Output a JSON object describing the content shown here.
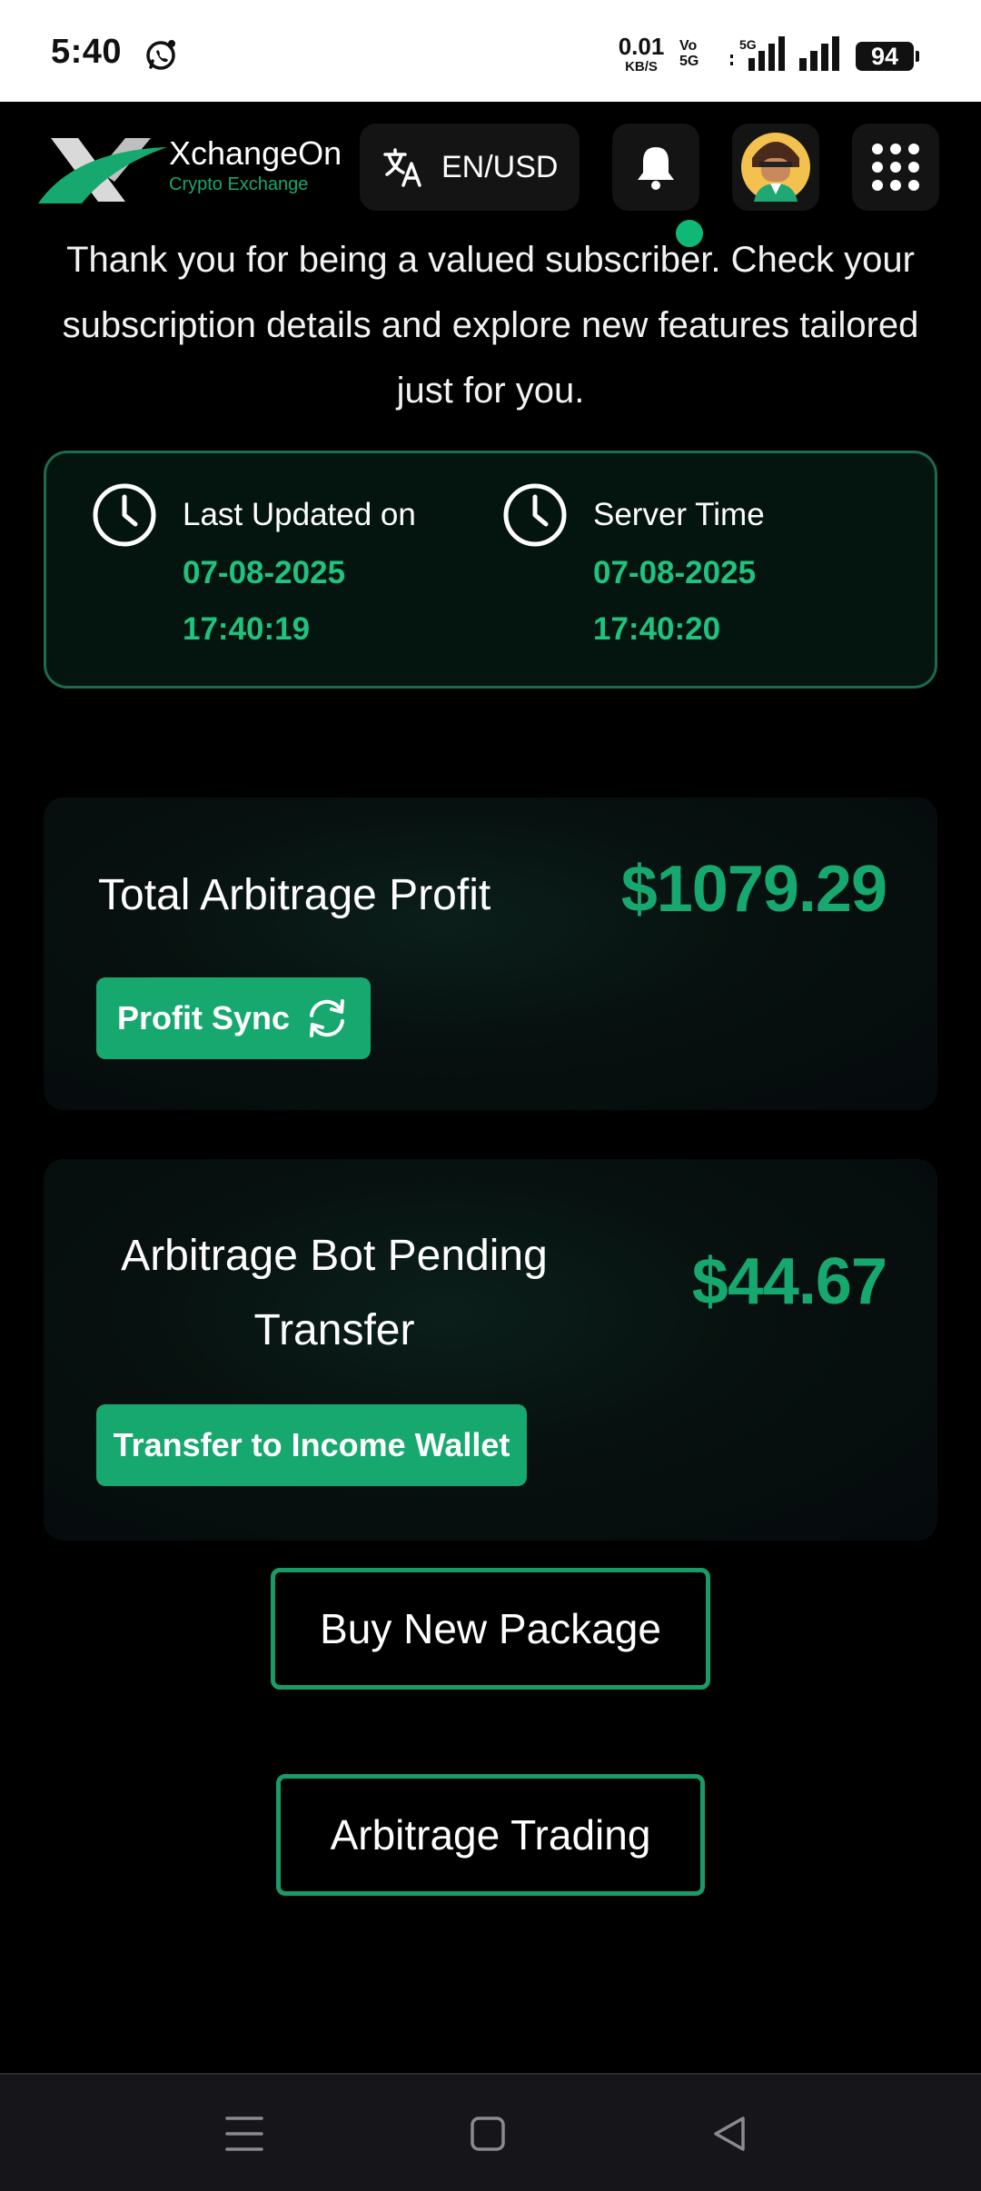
{
  "status_bar": {
    "time": "5:40",
    "net_speed": "0.01",
    "net_unit": "KB/S",
    "volte_top": "Vo",
    "volte_bottom": "5G",
    "network_type": "5G",
    "battery": "94"
  },
  "header": {
    "brand_name": "XchangeOn",
    "brand_subtitle": "Crypto Exchange",
    "language_label": "EN/USD",
    "colors": {
      "accent": "#17a870",
      "notification_dot": "#0fb876"
    }
  },
  "intro_text": "Thank you for being a valued subscriber. Check your subscription details and explore new features tailored just for you.",
  "time_card": {
    "last_updated": {
      "label": "Last Updated on",
      "date": "07-08-2025",
      "time": "17:40:19"
    },
    "server_time": {
      "label": "Server Time",
      "date": "07-08-2025",
      "time": "17:40:20"
    }
  },
  "profit_card": {
    "title": "Total Arbitrage Profit",
    "amount": "$1079.29",
    "button_label": "Profit Sync"
  },
  "pending_card": {
    "title": "Arbitrage Bot Pending Transfer",
    "amount": "$44.67",
    "button_label": "Transfer to Income Wallet"
  },
  "actions": {
    "buy_package": "Buy New Package",
    "arbitrage_trading": "Arbitrage Trading"
  },
  "nav": {
    "icons": [
      "menu-icon",
      "home-icon",
      "back-icon"
    ]
  }
}
